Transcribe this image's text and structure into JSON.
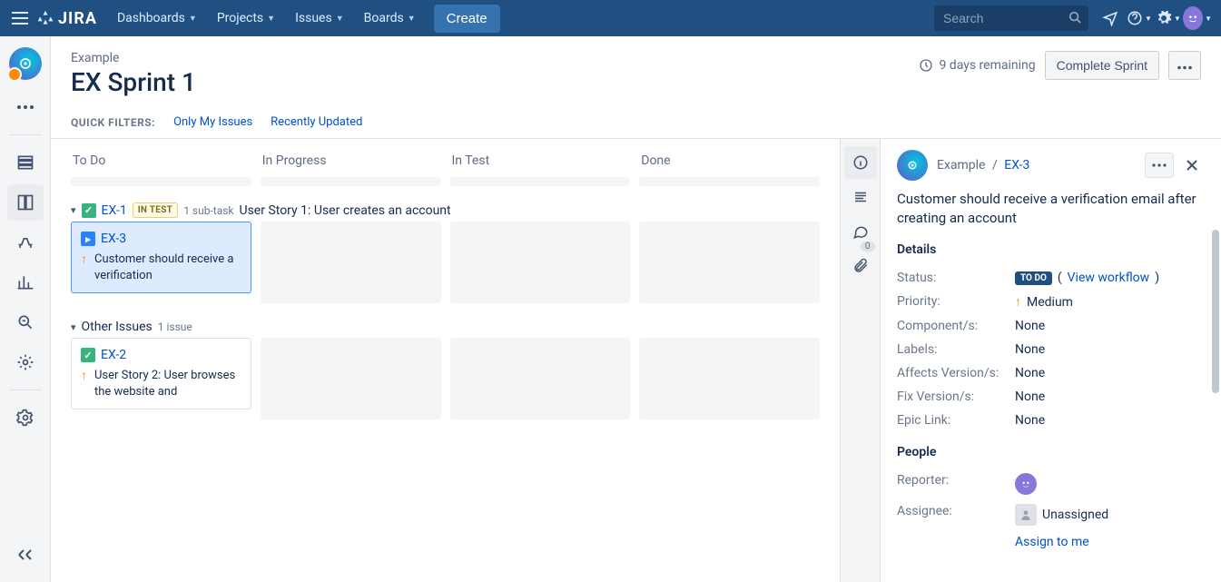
{
  "nav": {
    "logo_text": "JIRA",
    "items": [
      "Dashboards",
      "Projects",
      "Issues",
      "Boards"
    ],
    "create_label": "Create",
    "search_placeholder": "Search"
  },
  "header": {
    "project_name": "Example",
    "sprint_name": "EX Sprint 1",
    "remaining": "9 days remaining",
    "complete_label": "Complete Sprint",
    "quick_filters_label": "QUICK FILTERS:",
    "filters": [
      "Only My Issues",
      "Recently Updated"
    ]
  },
  "columns": [
    "To Do",
    "In Progress",
    "In Test",
    "Done"
  ],
  "swimlanes": [
    {
      "key": "EX-1",
      "status_lozenge": "IN TEST",
      "subtask_text": "1 sub-task",
      "summary": "User Story 1: User creates an account",
      "card": {
        "key": "EX-3",
        "summary": "Customer should receive a verification",
        "selected": true,
        "type": "subtask"
      }
    },
    {
      "label": "Other Issues",
      "count_text": "1 issue",
      "card": {
        "key": "EX-2",
        "summary": "User Story 2: User browses the website and",
        "selected": false,
        "type": "story"
      }
    }
  ],
  "panel": {
    "crumb_project": "Example",
    "crumb_sep": "/",
    "crumb_key": "EX-3",
    "title": "Customer should receive a verification email after creating an account",
    "details_heading": "Details",
    "status_label": "Status:",
    "status_value": "TO DO",
    "view_workflow": "View workflow",
    "priority_label": "Priority:",
    "priority_value": "Medium",
    "components_label": "Component/s:",
    "components_value": "None",
    "labels_label": "Labels:",
    "labels_value": "None",
    "affects_label": "Affects Version/s:",
    "affects_value": "None",
    "fix_label": "Fix Version/s:",
    "fix_value": "None",
    "epic_label": "Epic Link:",
    "epic_value": "None",
    "people_heading": "People",
    "reporter_label": "Reporter:",
    "assignee_label": "Assignee:",
    "assignee_value": "Unassigned",
    "assign_to_me": "Assign to me",
    "comment_badge": "0"
  }
}
